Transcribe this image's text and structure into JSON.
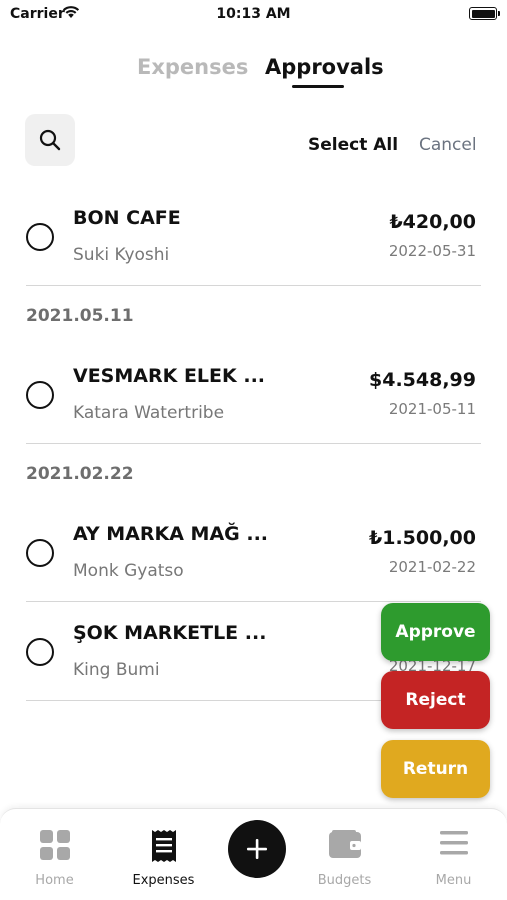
{
  "status_bar": {
    "carrier": "Carrier",
    "time": "10:13 AM"
  },
  "tabs": [
    {
      "label": "Expenses",
      "active": false
    },
    {
      "label": "Approvals",
      "active": true
    }
  ],
  "toolbar": {
    "select_all": "Select All",
    "cancel": "Cancel"
  },
  "items": [
    {
      "merchant": "BON CAFE",
      "person": "Suki Kyoshi",
      "amount": "₺420,00",
      "date": "2022-05-31"
    },
    {
      "merchant": "VESMARK ELEK ...",
      "person": "Katara Watertribe",
      "amount": "$4.548,99",
      "date": "2021-05-11"
    },
    {
      "merchant": "AY MARKA MAĞ ...",
      "person": "Monk Gyatso",
      "amount": "₺1.500,00",
      "date": "2021-02-22"
    },
    {
      "merchant": "ŞOK MARKETLE ...",
      "person": "King Bumi",
      "amount": "",
      "date": "2021-12-17"
    }
  ],
  "sections": [
    "2021.05.11",
    "2021.02.22"
  ],
  "actions": {
    "approve": {
      "label": "Approve",
      "color": "#2e9b2e"
    },
    "reject": {
      "label": "Reject",
      "color": "#c42424"
    },
    "return": {
      "label": "Return",
      "color": "#e0a91f"
    }
  },
  "bottom_nav": [
    {
      "label": "Home",
      "icon": "grid-icon",
      "active": false
    },
    {
      "label": "Expenses",
      "icon": "receipt-icon",
      "active": true
    },
    {
      "label": "",
      "icon": "plus-icon",
      "active": false
    },
    {
      "label": "Budgets",
      "icon": "wallet-icon",
      "active": false
    },
    {
      "label": "Menu",
      "icon": "hamburger-icon",
      "active": false
    }
  ]
}
